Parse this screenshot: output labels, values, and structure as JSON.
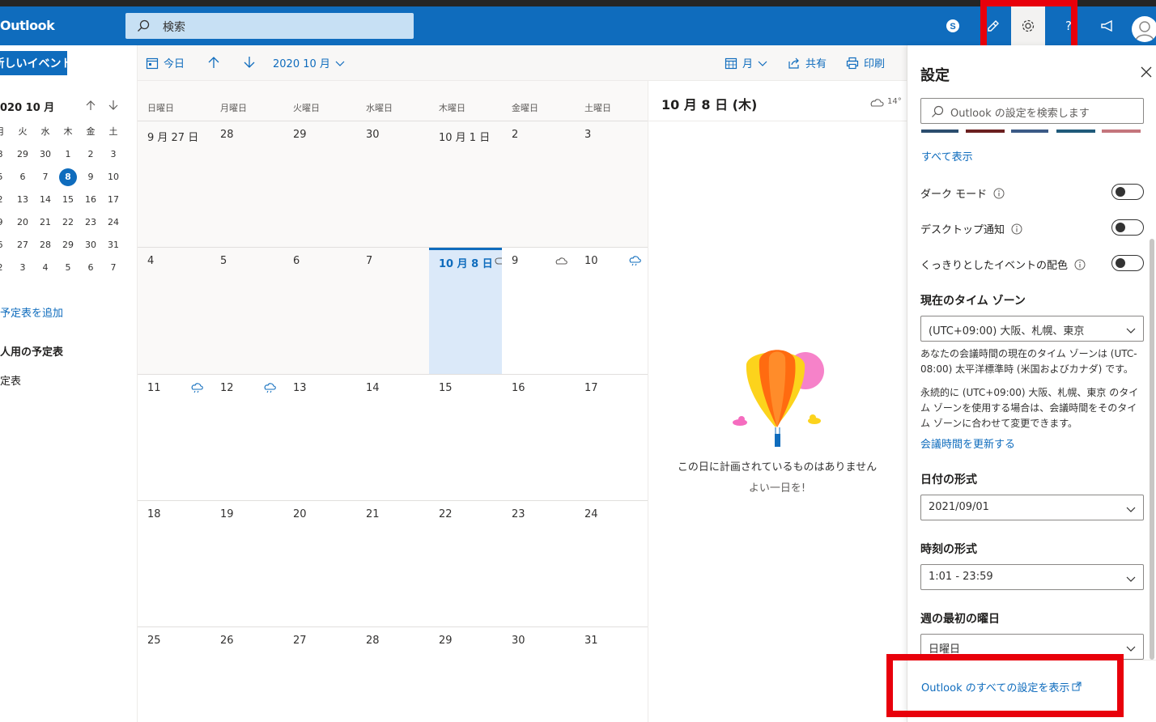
{
  "app": {
    "brand": "Outlook",
    "search_placeholder": "検索"
  },
  "toolbar_icons": [
    "skype-icon",
    "feedback-icon",
    "settings-icon",
    "help-icon",
    "announcement-icon",
    "avatar"
  ],
  "leftnav": {
    "new_event": "新しいイベント",
    "mini_title": "020 10 月",
    "weekday_headers": [
      "月",
      "火",
      "水",
      "木",
      "金",
      "土"
    ],
    "weeks": [
      [
        "8",
        "29",
        "30",
        "1",
        "2",
        "3"
      ],
      [
        "5",
        "6",
        "7",
        "8",
        "9",
        "10"
      ],
      [
        "2",
        "13",
        "14",
        "15",
        "16",
        "17"
      ],
      [
        "9",
        "20",
        "21",
        "22",
        "23",
        "24"
      ],
      [
        "6",
        "27",
        "28",
        "29",
        "30",
        "31"
      ],
      [
        "2",
        "3",
        "4",
        "5",
        "6",
        "7"
      ]
    ],
    "selected_day": "8",
    "add_calendar": "予定表を追加",
    "personal_header": "人用の予定表",
    "calendar_item": "定表"
  },
  "command_bar": {
    "today": "今日",
    "month_label": "2020 10 月",
    "view": "月",
    "share": "共有",
    "print": "印刷"
  },
  "calendar": {
    "weekday_headers": [
      "日曜日",
      "月曜日",
      "火曜日",
      "水曜日",
      "木曜日",
      "金曜日",
      "土曜日"
    ],
    "weeks": [
      [
        "9 月 27 日",
        "28",
        "29",
        "30",
        "10 月 1 日",
        "2",
        "3"
      ],
      [
        "4",
        "5",
        "6",
        "7",
        "10 月 8 日",
        "9",
        "10"
      ],
      [
        "11",
        "12",
        "13",
        "14",
        "15",
        "16",
        "17"
      ],
      [
        "18",
        "19",
        "20",
        "21",
        "22",
        "23",
        "24"
      ],
      [
        "25",
        "26",
        "27",
        "28",
        "29",
        "30",
        "31"
      ]
    ]
  },
  "day_pane": {
    "title": "10 月 8 日 (木)",
    "temperature": "14°",
    "empty_message": "この日に計画されているものはありません",
    "empty_sub": "よい一日を!"
  },
  "settings": {
    "title": "設定",
    "search_placeholder": "Outlook の設定を検索します",
    "show_all": "すべて表示",
    "dark_mode": "ダーク モード",
    "desktop_notify": "デスクトップ通知",
    "vivid_colors": "くっきりとしたイベントの配色",
    "timezone_label": "現在のタイム ゾーン",
    "timezone_value": "(UTC+09:00) 大阪、札幌、東京",
    "timezone_note1": "あなたの会議時間の現在のタイム ゾーンは (UTC-08:00) 太平洋標準時 (米国およびカナダ) です。",
    "timezone_note2": "永続的に (UTC+09:00) 大阪、札幌、東京 のタイム ゾーンを使用する場合は、会議時間をそのタイム ゾーンに合わせて変更できます。",
    "update_link": "会議時間を更新する",
    "date_format_label": "日付の形式",
    "date_format_value": "2021/09/01",
    "time_format_label": "時刻の形式",
    "time_format_value": "1:01 - 23:59",
    "first_day_label": "週の最初の曜日",
    "first_day_value": "日曜日",
    "all_settings_link": "Outlook のすべての設定を表示"
  },
  "colors": {
    "accent": "#0f6cbd",
    "highlight": "#e8000b",
    "today_bg": "#dbe9f9"
  }
}
